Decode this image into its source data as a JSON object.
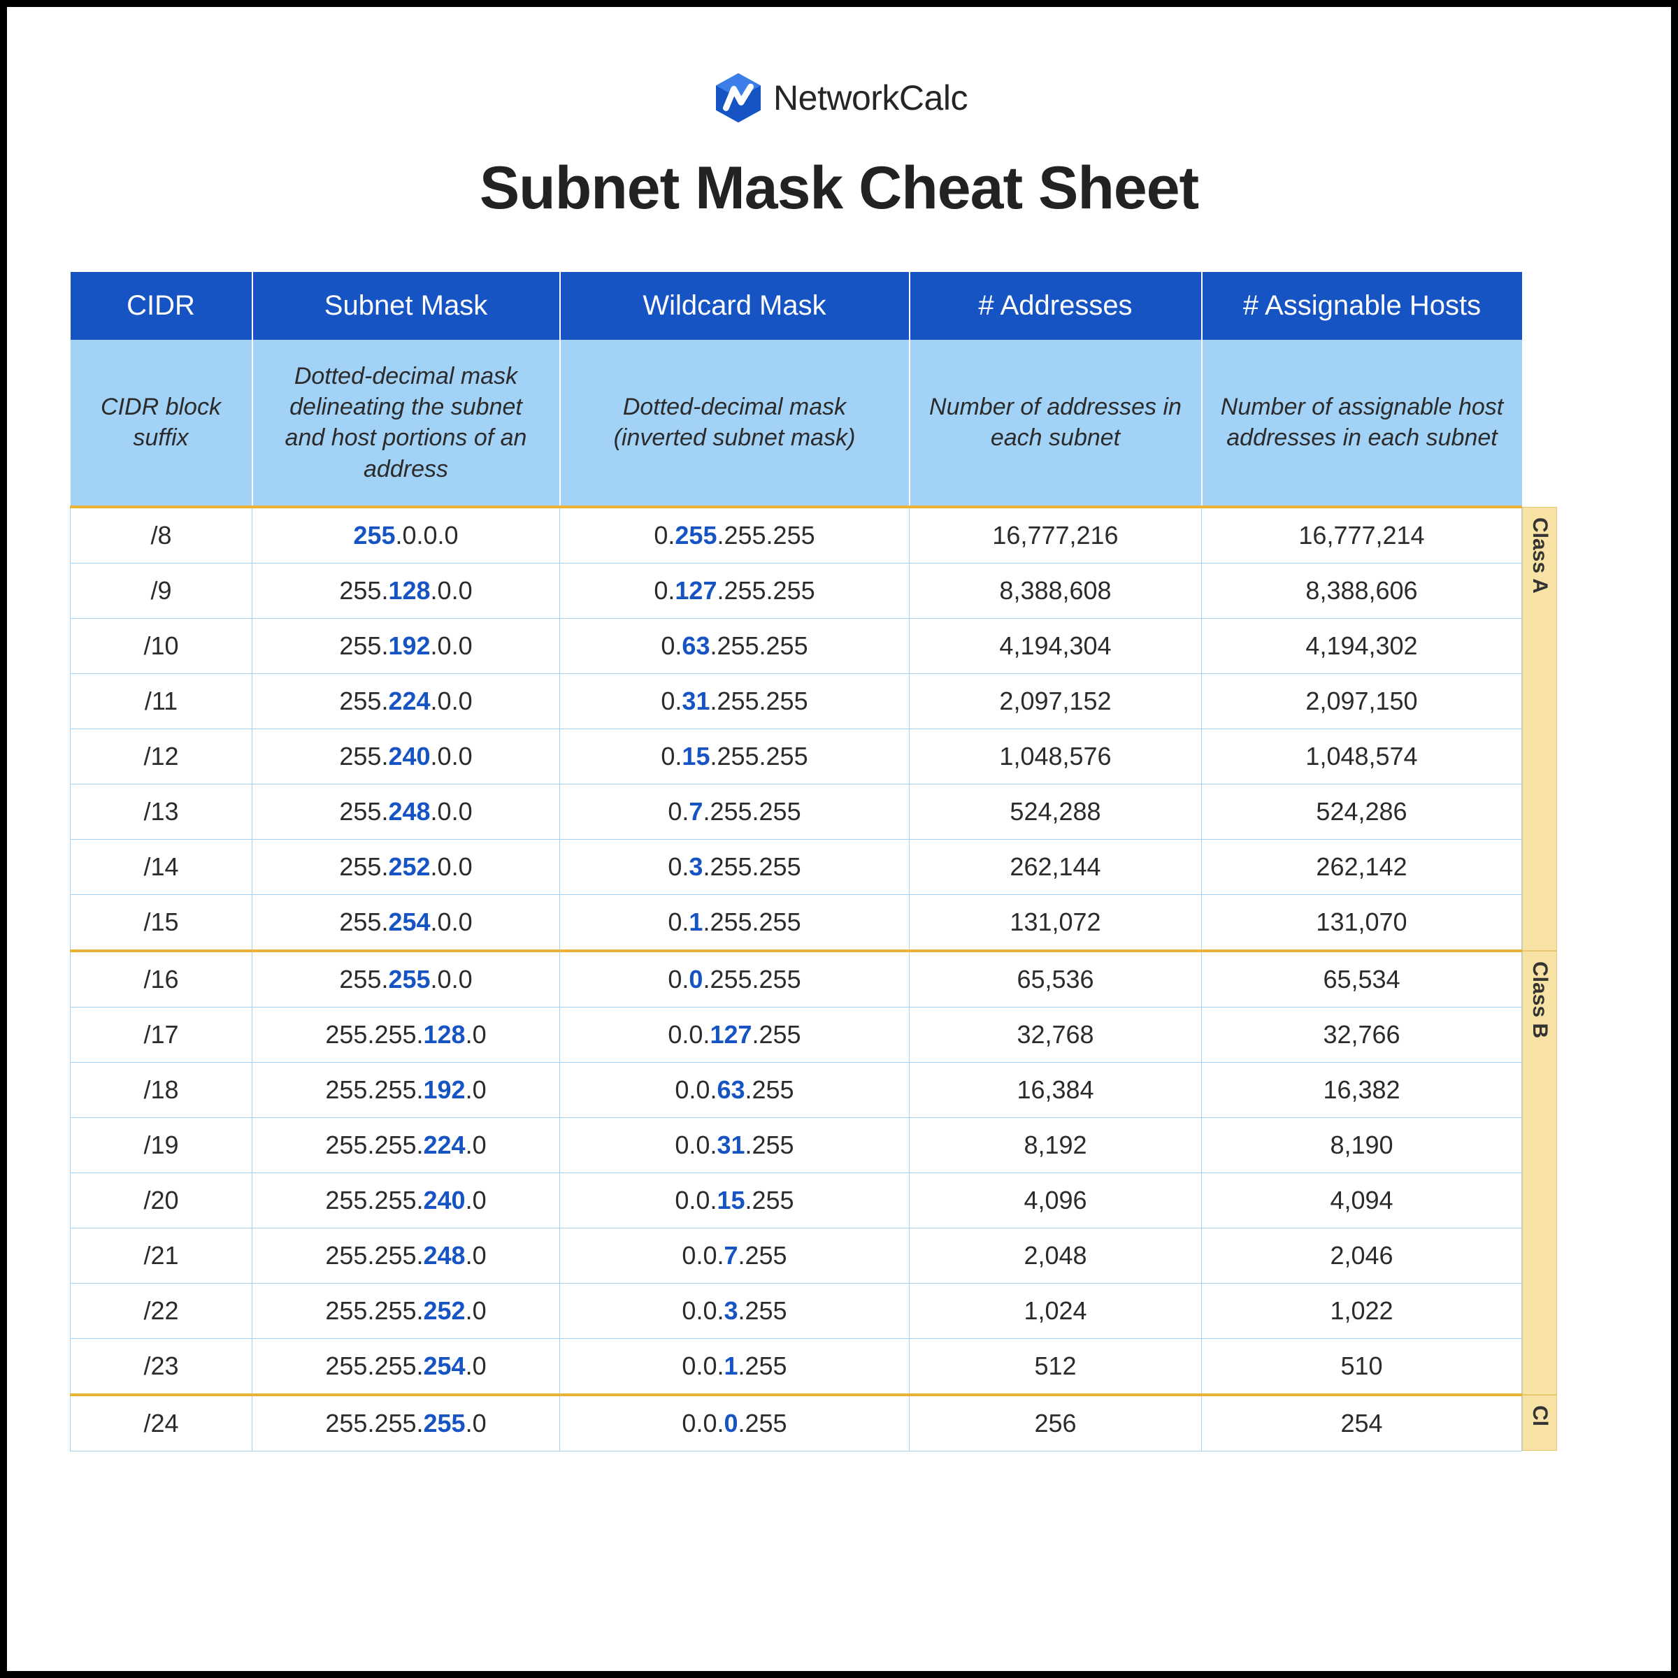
{
  "brand": {
    "name": "NetworkCalc"
  },
  "title": "Subnet Mask Cheat Sheet",
  "headers": {
    "cidr": "CIDR",
    "subnet": "Subnet Mask",
    "wildcard": "Wildcard Mask",
    "addresses": "# Addresses",
    "hosts": "# Assignable Hosts"
  },
  "descriptions": {
    "cidr": "CIDR block suffix",
    "subnet": "Dotted-decimal mask delineating the subnet and host portions of an address",
    "wildcard": "Dotted-decimal mask (inverted subnet mask)",
    "addresses": "Number of addresses in each subnet",
    "hosts": "Number of assignable host addresses in each subnet"
  },
  "class_labels": {
    "a": "Class A",
    "b": "Class B",
    "c": "Cl"
  },
  "rows": [
    {
      "cidr": "/8",
      "sm_pre": "",
      "sm_hl": "255",
      "sm_post": ".0.0.0",
      "wc_pre": "0.",
      "wc_hl": "255",
      "wc_post": ".255.255",
      "addr": "16,777,216",
      "hosts": "16,777,214",
      "sep": false
    },
    {
      "cidr": "/9",
      "sm_pre": "255.",
      "sm_hl": "128",
      "sm_post": ".0.0",
      "wc_pre": "0.",
      "wc_hl": "127",
      "wc_post": ".255.255",
      "addr": "8,388,608",
      "hosts": "8,388,606",
      "sep": false
    },
    {
      "cidr": "/10",
      "sm_pre": "255.",
      "sm_hl": "192",
      "sm_post": ".0.0",
      "wc_pre": "0.",
      "wc_hl": "63",
      "wc_post": ".255.255",
      "addr": "4,194,304",
      "hosts": "4,194,302",
      "sep": false
    },
    {
      "cidr": "/11",
      "sm_pre": "255.",
      "sm_hl": "224",
      "sm_post": ".0.0",
      "wc_pre": "0.",
      "wc_hl": "31",
      "wc_post": ".255.255",
      "addr": "2,097,152",
      "hosts": "2,097,150",
      "sep": false
    },
    {
      "cidr": "/12",
      "sm_pre": "255.",
      "sm_hl": "240",
      "sm_post": ".0.0",
      "wc_pre": "0.",
      "wc_hl": "15",
      "wc_post": ".255.255",
      "addr": "1,048,576",
      "hosts": "1,048,574",
      "sep": false
    },
    {
      "cidr": "/13",
      "sm_pre": "255.",
      "sm_hl": "248",
      "sm_post": ".0.0",
      "wc_pre": "0.",
      "wc_hl": "7",
      "wc_post": ".255.255",
      "addr": "524,288",
      "hosts": "524,286",
      "sep": false
    },
    {
      "cidr": "/14",
      "sm_pre": "255.",
      "sm_hl": "252",
      "sm_post": ".0.0",
      "wc_pre": "0.",
      "wc_hl": "3",
      "wc_post": ".255.255",
      "addr": "262,144",
      "hosts": "262,142",
      "sep": false
    },
    {
      "cidr": "/15",
      "sm_pre": "255.",
      "sm_hl": "254",
      "sm_post": ".0.0",
      "wc_pre": "0.",
      "wc_hl": "1",
      "wc_post": ".255.255",
      "addr": "131,072",
      "hosts": "131,070",
      "sep": true
    },
    {
      "cidr": "/16",
      "sm_pre": "255.",
      "sm_hl": "255",
      "sm_post": ".0.0",
      "wc_pre": "0.",
      "wc_hl": "0",
      "wc_post": ".255.255",
      "addr": "65,536",
      "hosts": "65,534",
      "sep": false
    },
    {
      "cidr": "/17",
      "sm_pre": "255.255.",
      "sm_hl": "128",
      "sm_post": ".0",
      "wc_pre": "0.0.",
      "wc_hl": "127",
      "wc_post": ".255",
      "addr": "32,768",
      "hosts": "32,766",
      "sep": false
    },
    {
      "cidr": "/18",
      "sm_pre": "255.255.",
      "sm_hl": "192",
      "sm_post": ".0",
      "wc_pre": "0.0.",
      "wc_hl": "63",
      "wc_post": ".255",
      "addr": "16,384",
      "hosts": "16,382",
      "sep": false
    },
    {
      "cidr": "/19",
      "sm_pre": "255.255.",
      "sm_hl": "224",
      "sm_post": ".0",
      "wc_pre": "0.0.",
      "wc_hl": "31",
      "wc_post": ".255",
      "addr": "8,192",
      "hosts": "8,190",
      "sep": false
    },
    {
      "cidr": "/20",
      "sm_pre": "255.255.",
      "sm_hl": "240",
      "sm_post": ".0",
      "wc_pre": "0.0.",
      "wc_hl": "15",
      "wc_post": ".255",
      "addr": "4,096",
      "hosts": "4,094",
      "sep": false
    },
    {
      "cidr": "/21",
      "sm_pre": "255.255.",
      "sm_hl": "248",
      "sm_post": ".0",
      "wc_pre": "0.0.",
      "wc_hl": "7",
      "wc_post": ".255",
      "addr": "2,048",
      "hosts": "2,046",
      "sep": false
    },
    {
      "cidr": "/22",
      "sm_pre": "255.255.",
      "sm_hl": "252",
      "sm_post": ".0",
      "wc_pre": "0.0.",
      "wc_hl": "3",
      "wc_post": ".255",
      "addr": "1,024",
      "hosts": "1,022",
      "sep": false
    },
    {
      "cidr": "/23",
      "sm_pre": "255.255.",
      "sm_hl": "254",
      "sm_post": ".0",
      "wc_pre": "0.0.",
      "wc_hl": "1",
      "wc_post": ".255",
      "addr": "512",
      "hosts": "510",
      "sep": true
    },
    {
      "cidr": "/24",
      "sm_pre": "255.255.",
      "sm_hl": "255",
      "sm_post": ".0",
      "wc_pre": "0.0.",
      "wc_hl": "0",
      "wc_post": ".255",
      "addr": "256",
      "hosts": "254",
      "sep": false
    }
  ]
}
